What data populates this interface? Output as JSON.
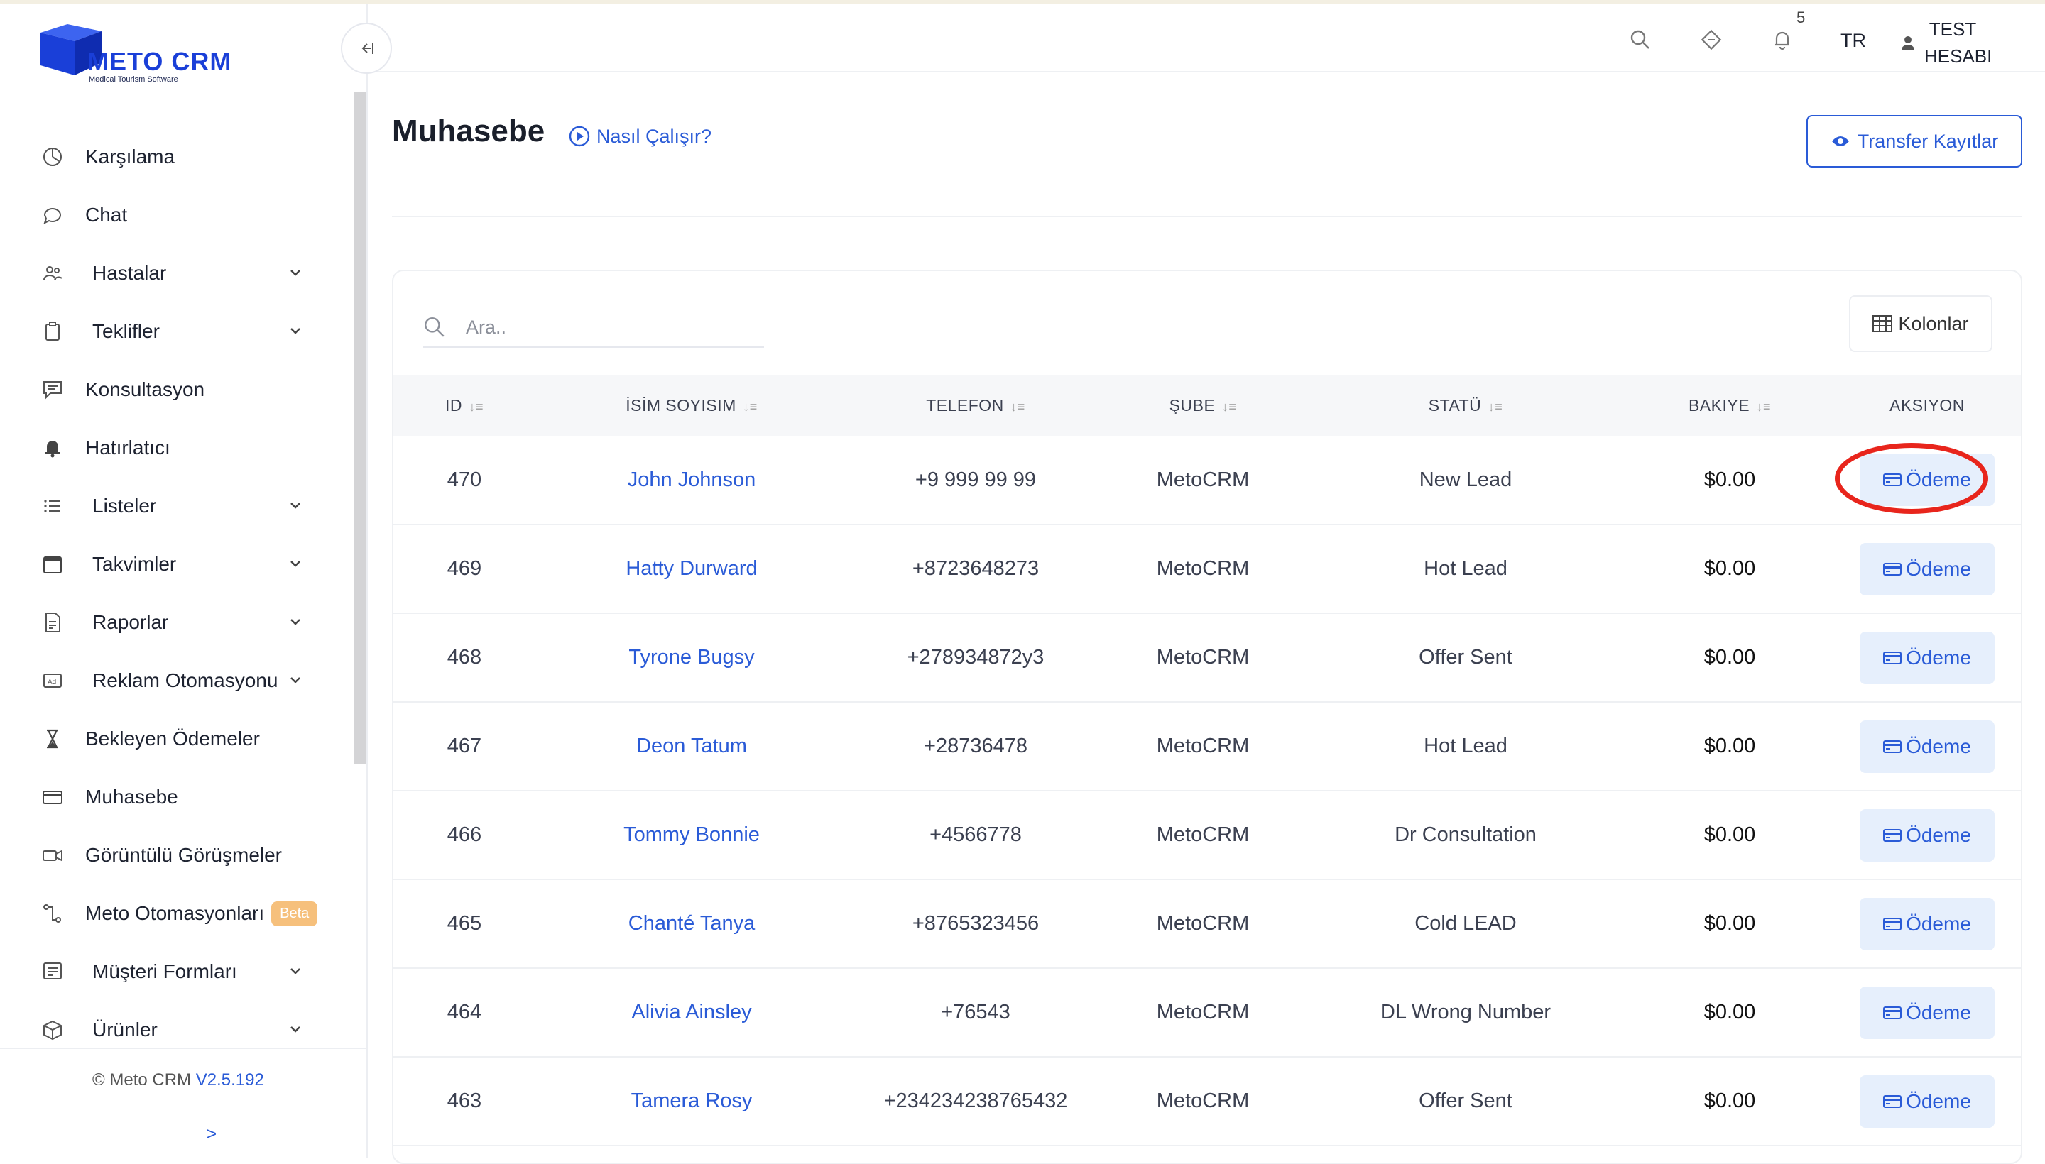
{
  "brand": {
    "name": "METO CRM",
    "tagline": "Medical Tourism Software"
  },
  "sidebar": {
    "items": [
      {
        "label": "Karşılama",
        "icon": "dashboard-icon",
        "has_children": false
      },
      {
        "label": "Chat",
        "icon": "chat-bubble-icon",
        "has_children": false
      },
      {
        "label": "Hastalar",
        "icon": "users-icon",
        "has_children": true
      },
      {
        "label": "Teklifler",
        "icon": "clipboard-icon",
        "has_children": true
      },
      {
        "label": "Konsultasyon",
        "icon": "message-icon",
        "has_children": false
      },
      {
        "label": "Hatırlatıcı",
        "icon": "bell-icon",
        "has_children": false
      },
      {
        "label": "Listeler",
        "icon": "list-icon",
        "has_children": true
      },
      {
        "label": "Takvimler",
        "icon": "calendar-icon",
        "has_children": true
      },
      {
        "label": "Raporlar",
        "icon": "report-icon",
        "has_children": true
      },
      {
        "label": "Reklam Otomasyonu",
        "icon": "ad-icon",
        "has_children": true
      },
      {
        "label": "Bekleyen Ödemeler",
        "icon": "hourglass-icon",
        "has_children": false
      },
      {
        "label": "Muhasebe",
        "icon": "credit-card-icon",
        "has_children": false
      },
      {
        "label": "Görüntülü Görüşmeler",
        "icon": "video-icon",
        "has_children": false
      },
      {
        "label": "Meto Otomasyonları",
        "icon": "automation-icon",
        "has_children": false,
        "badge": "Beta"
      },
      {
        "label": "Müşteri Formları",
        "icon": "form-icon",
        "has_children": true
      },
      {
        "label": "Ürünler",
        "icon": "box-icon",
        "has_children": true
      }
    ],
    "footer": {
      "copyright": "© Meto CRM",
      "version": "V2.5.192",
      "expand_label": ">"
    }
  },
  "header": {
    "notification_count": "5",
    "language": "TR",
    "user_line1": "TEST",
    "user_line2": "HESABI"
  },
  "page": {
    "title": "Muhasebe",
    "how_it_works": "Nasıl Çalışır?",
    "transfer_button": "Transfer Kayıtlar"
  },
  "table": {
    "search_placeholder": "Ara..",
    "columns_button": "Kolonlar",
    "headers": [
      "ID",
      "İSİM SOYISIM",
      "TELEFON",
      "ŞUBE",
      "STATÜ",
      "BAKIYE",
      "AKSIYON"
    ],
    "action_label": "Ödeme",
    "rows": [
      {
        "id": "470",
        "name": "John Johnson",
        "phone": "+9 999 99 99",
        "branch": "MetoCRM",
        "status": "New Lead",
        "balance": "$0.00"
      },
      {
        "id": "469",
        "name": "Hatty Durward",
        "phone": "+8723648273",
        "branch": "MetoCRM",
        "status": "Hot Lead",
        "balance": "$0.00"
      },
      {
        "id": "468",
        "name": "Tyrone Bugsy",
        "phone": "+278934872y3",
        "branch": "MetoCRM",
        "status": "Offer Sent",
        "balance": "$0.00"
      },
      {
        "id": "467",
        "name": "Deon Tatum",
        "phone": "+28736478",
        "branch": "MetoCRM",
        "status": "Hot Lead",
        "balance": "$0.00"
      },
      {
        "id": "466",
        "name": "Tommy Bonnie",
        "phone": "+4566778",
        "branch": "MetoCRM",
        "status": "Dr Consultation",
        "balance": "$0.00"
      },
      {
        "id": "465",
        "name": "Chanté Tanya",
        "phone": "+8765323456",
        "branch": "MetoCRM",
        "status": "Cold LEAD",
        "balance": "$0.00"
      },
      {
        "id": "464",
        "name": "Alivia Ainsley",
        "phone": "+76543",
        "branch": "MetoCRM",
        "status": "DL Wrong Number",
        "balance": "$0.00"
      },
      {
        "id": "463",
        "name": "Tamera Rosy",
        "phone": "+234234238765432",
        "branch": "MetoCRM",
        "status": "Offer Sent",
        "balance": "$0.00"
      }
    ]
  },
  "colors": {
    "accent": "#2a5bd7",
    "brand_blue": "#1a3fd8",
    "highlight": "#e8251c",
    "beta": "#f6c07c"
  }
}
